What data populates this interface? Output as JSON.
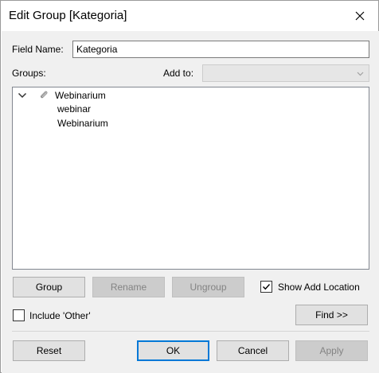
{
  "window": {
    "title": "Edit Group [Kategoria]",
    "close_icon": "close-icon"
  },
  "field_name": {
    "label": "Field Name:",
    "value": "Kategoria"
  },
  "groups": {
    "label": "Groups:",
    "add_to_label": "Add to:",
    "add_to_value": ""
  },
  "tree": {
    "group": {
      "label": "Webinarium",
      "expanded": true,
      "icon": "paperclip-icon",
      "members": [
        "webinar",
        "Webinarium"
      ]
    }
  },
  "buttons": {
    "group": "Group",
    "rename": "Rename",
    "ungroup": "Ungroup",
    "find": "Find >>",
    "reset": "Reset",
    "ok": "OK",
    "cancel": "Cancel",
    "apply": "Apply"
  },
  "options": {
    "show_add_location": {
      "label": "Show Add Location",
      "checked": true
    },
    "include_other": {
      "label": "Include 'Other'",
      "checked": false
    }
  },
  "colors": {
    "accent": "#0078d7",
    "dialog_bg": "#f0f0f0"
  }
}
